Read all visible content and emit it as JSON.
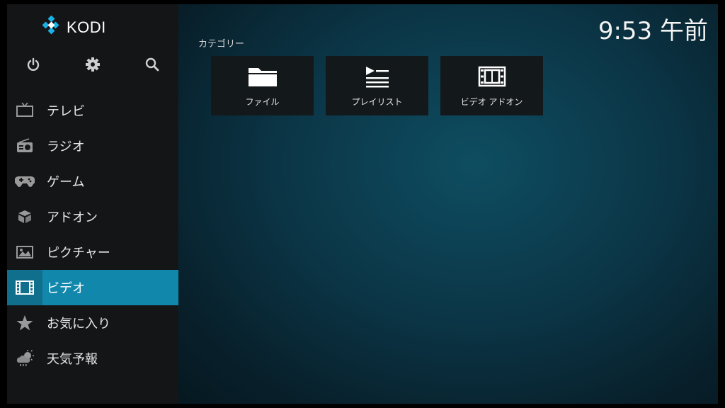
{
  "app": {
    "name": "KODI"
  },
  "clock": "9:53 午前",
  "top_icons": [
    "power-icon",
    "gear-icon",
    "search-icon"
  ],
  "menu": {
    "items": [
      {
        "label": "テレビ",
        "icon": "tv-icon"
      },
      {
        "label": "ラジオ",
        "icon": "radio-icon"
      },
      {
        "label": "ゲーム",
        "icon": "gamepad-icon"
      },
      {
        "label": "アドオン",
        "icon": "addons-box-icon"
      },
      {
        "label": "ピクチャー",
        "icon": "picture-icon"
      },
      {
        "label": "ビデオ",
        "icon": "film-icon",
        "active": true
      },
      {
        "label": "お気に入り",
        "icon": "star-icon"
      },
      {
        "label": "天気予報",
        "icon": "weather-icon"
      }
    ]
  },
  "content": {
    "section_title": "カテゴリー",
    "tiles": [
      {
        "label": "ファイル",
        "icon": "folder-icon"
      },
      {
        "label": "プレイリスト",
        "icon": "playlist-icon"
      },
      {
        "label": "ビデオ アドオン",
        "icon": "film-icon"
      }
    ]
  },
  "colors": {
    "accent": "#1287ac",
    "sidebar_bg": "#141517",
    "background": "#0b3647",
    "tile_bg": "#13181b"
  }
}
